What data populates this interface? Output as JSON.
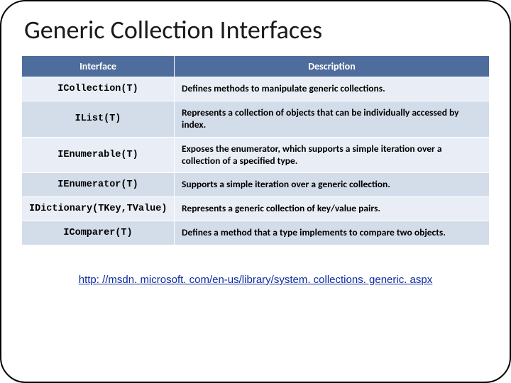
{
  "title": "Generic Collection Interfaces",
  "headers": {
    "col1": "Interface",
    "col2": "Description"
  },
  "rows": [
    {
      "name": "ICollection(T)",
      "desc": "Defines methods to manipulate generic collections."
    },
    {
      "name": "IList(T)",
      "desc": "Represents a collection of objects that can be individually accessed by index."
    },
    {
      "name": "IEnumerable(T)",
      "desc": "Exposes the enumerator, which supports a simple iteration over a collection of a specified type."
    },
    {
      "name": "IEnumerator(T)",
      "desc": "Supports a simple iteration over a generic collection."
    },
    {
      "name": "IDictionary(TKey,TValue)",
      "desc": "Represents a generic collection of key/value pairs."
    },
    {
      "name": "IComparer(T)",
      "desc": "Defines a method that a type implements to compare two objects."
    }
  ],
  "link": {
    "text": "http: //msdn. microsoft. com/en-us/library/system. collections. generic. aspx"
  }
}
